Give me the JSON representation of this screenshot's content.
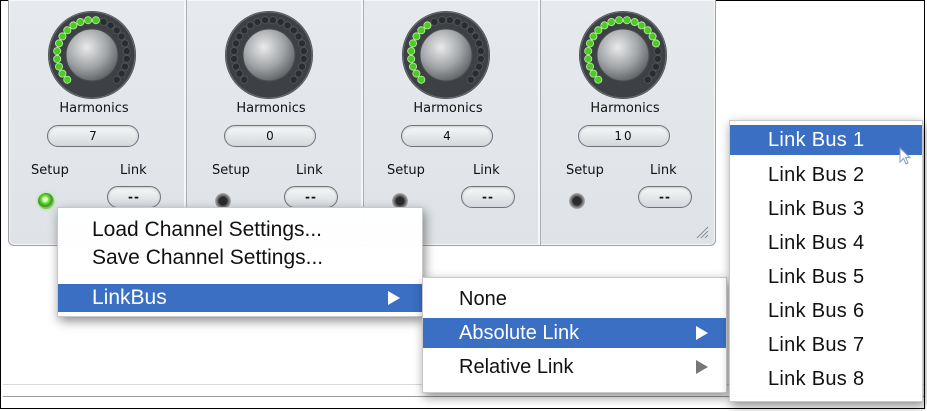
{
  "colors": {
    "accent": "#3a6fc4",
    "led_green": "#4fc82a",
    "panel": "#e2e6ea"
  },
  "channels": [
    {
      "label": "Harmonics",
      "value": "7",
      "setup_label": "Setup",
      "link_label": "Link",
      "link_value": "--",
      "setup_led": "on",
      "knob_level": 0.55
    },
    {
      "label": "Harmonics",
      "value": "0",
      "setup_label": "Setup",
      "link_label": "Link",
      "link_value": "--",
      "setup_led": "off",
      "knob_level": 0.0
    },
    {
      "label": "Harmonics",
      "value": "4",
      "setup_label": "Setup",
      "link_label": "Link",
      "link_value": "--",
      "setup_led": "off",
      "knob_level": 0.4
    },
    {
      "label": "Harmonics",
      "value": "10",
      "setup_label": "Setup",
      "link_label": "Link",
      "link_value": "--",
      "setup_led": "off",
      "knob_level": 0.75
    }
  ],
  "context_menu": {
    "items": [
      {
        "label": "Load Channel Settings...",
        "selected": false,
        "submenu": false
      },
      {
        "label": "Save Channel Settings...",
        "selected": false,
        "submenu": false
      },
      {
        "label": "LinkBus",
        "selected": true,
        "submenu": true
      }
    ]
  },
  "linkbus_menu": {
    "items": [
      {
        "label": "None",
        "selected": false,
        "submenu": false
      },
      {
        "label": "Absolute Link",
        "selected": true,
        "submenu": true
      },
      {
        "label": "Relative Link",
        "selected": false,
        "submenu": true
      }
    ]
  },
  "bus_menu": {
    "items": [
      {
        "label": "Link Bus 1",
        "selected": true
      },
      {
        "label": "Link Bus 2",
        "selected": false
      },
      {
        "label": "Link Bus 3",
        "selected": false
      },
      {
        "label": "Link Bus 4",
        "selected": false
      },
      {
        "label": "Link Bus 5",
        "selected": false
      },
      {
        "label": "Link Bus 6",
        "selected": false
      },
      {
        "label": "Link Bus 7",
        "selected": false
      },
      {
        "label": "Link Bus 8",
        "selected": false
      }
    ]
  }
}
